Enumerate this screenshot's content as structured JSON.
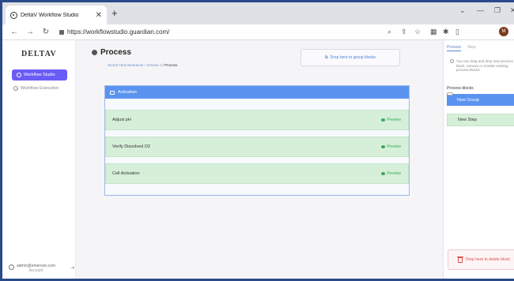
{
  "browser": {
    "tab_title": "DeltaV Workflow Studio",
    "tab_close": "✕",
    "new_tab": "+",
    "url": "https://workflowstudio.guardian.com/",
    "avatar_initial": "M"
  },
  "sidebar": {
    "logo": "DELTAV",
    "items": [
      {
        "label": "Workflow Studio",
        "active": true
      },
      {
        "label": "Workflow Execution",
        "active": false
      }
    ],
    "user_email": "admin@emerson.com",
    "user_role": "Account"
  },
  "main": {
    "title": "Process",
    "breadcrumb": {
      "link": "Stored Tank Bioreactor / Version 1",
      "current": "Process"
    },
    "drop_group_hint": "Drop here to group blocks",
    "group": {
      "name": "Activation",
      "steps": [
        {
          "name": "Adjust pH",
          "action": "Preview"
        },
        {
          "name": "Verify Dissolved O2",
          "action": "Preview"
        },
        {
          "name": "Cell Activation",
          "action": "Preview"
        }
      ]
    }
  },
  "right_panel": {
    "tabs": [
      {
        "label": "Process",
        "active": true
      },
      {
        "label": "Step",
        "active": false
      }
    ],
    "hint": "You can drag and drop new process block, remove or reorder existing process blocks",
    "section_title": "Process blocks",
    "blocks": {
      "group_label": "New Group",
      "step_label": "New Step"
    },
    "drop_delete_hint": "Drop here to delete block"
  },
  "colors": {
    "accent": "#6a5cf6",
    "group_blue": "#5b93f0",
    "step_green": "#d6efd9",
    "preview_green": "#3aaa5c",
    "delete_red": "#e04b4b"
  }
}
